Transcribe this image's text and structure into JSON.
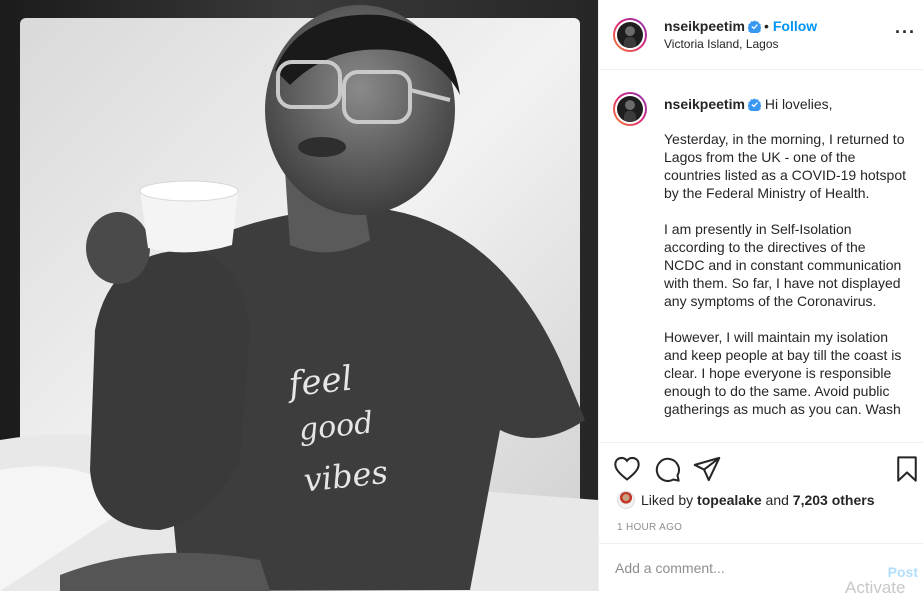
{
  "post": {
    "photo_alt": "Black and white photo of a woman in glasses holding a white mug, wearing a t-shirt printed with feel good vibes",
    "shirt_text": "feel good vibes"
  },
  "header": {
    "username": "nseikpeetim",
    "separator": "•",
    "follow_label": "Follow",
    "location": "Victoria Island, Lagos",
    "more_label": "···"
  },
  "caption": {
    "username": "nseikpeetim",
    "first_line": "Hi lovelies,",
    "paragraphs": [
      "Yesterday, in the morning, I returned to Lagos from the UK - one of the countries listed as a COVID-19 hotspot by the Federal Ministry of Health.",
      "I am presently in Self-Isolation according to the directives of the NCDC and in constant communication with them. So far, I have not displayed any symptoms of the Coronavirus.",
      "However, I will maintain my isolation and keep people at bay till the coast is clear. I hope everyone is responsible enough to do the same. Avoid public gatherings as much as you can. Wash"
    ]
  },
  "actions": {
    "like_icon": "heart-icon",
    "comment_icon": "comment-icon",
    "share_icon": "share-icon",
    "save_icon": "bookmark-icon",
    "liked_by_prefix": "Liked by",
    "liked_by_user": "topealake",
    "liked_by_and": "and",
    "others_count": "7,203 others",
    "timestamp": "1 HOUR AGO"
  },
  "comment": {
    "placeholder": "Add a comment...",
    "post_label": "Post",
    "overlay_text": "Activate"
  },
  "colors": {
    "accent_blue": "#0095f6",
    "post_disabled": "#b2dffc",
    "muted_text": "#8e8e8e",
    "border": "#efefef"
  }
}
